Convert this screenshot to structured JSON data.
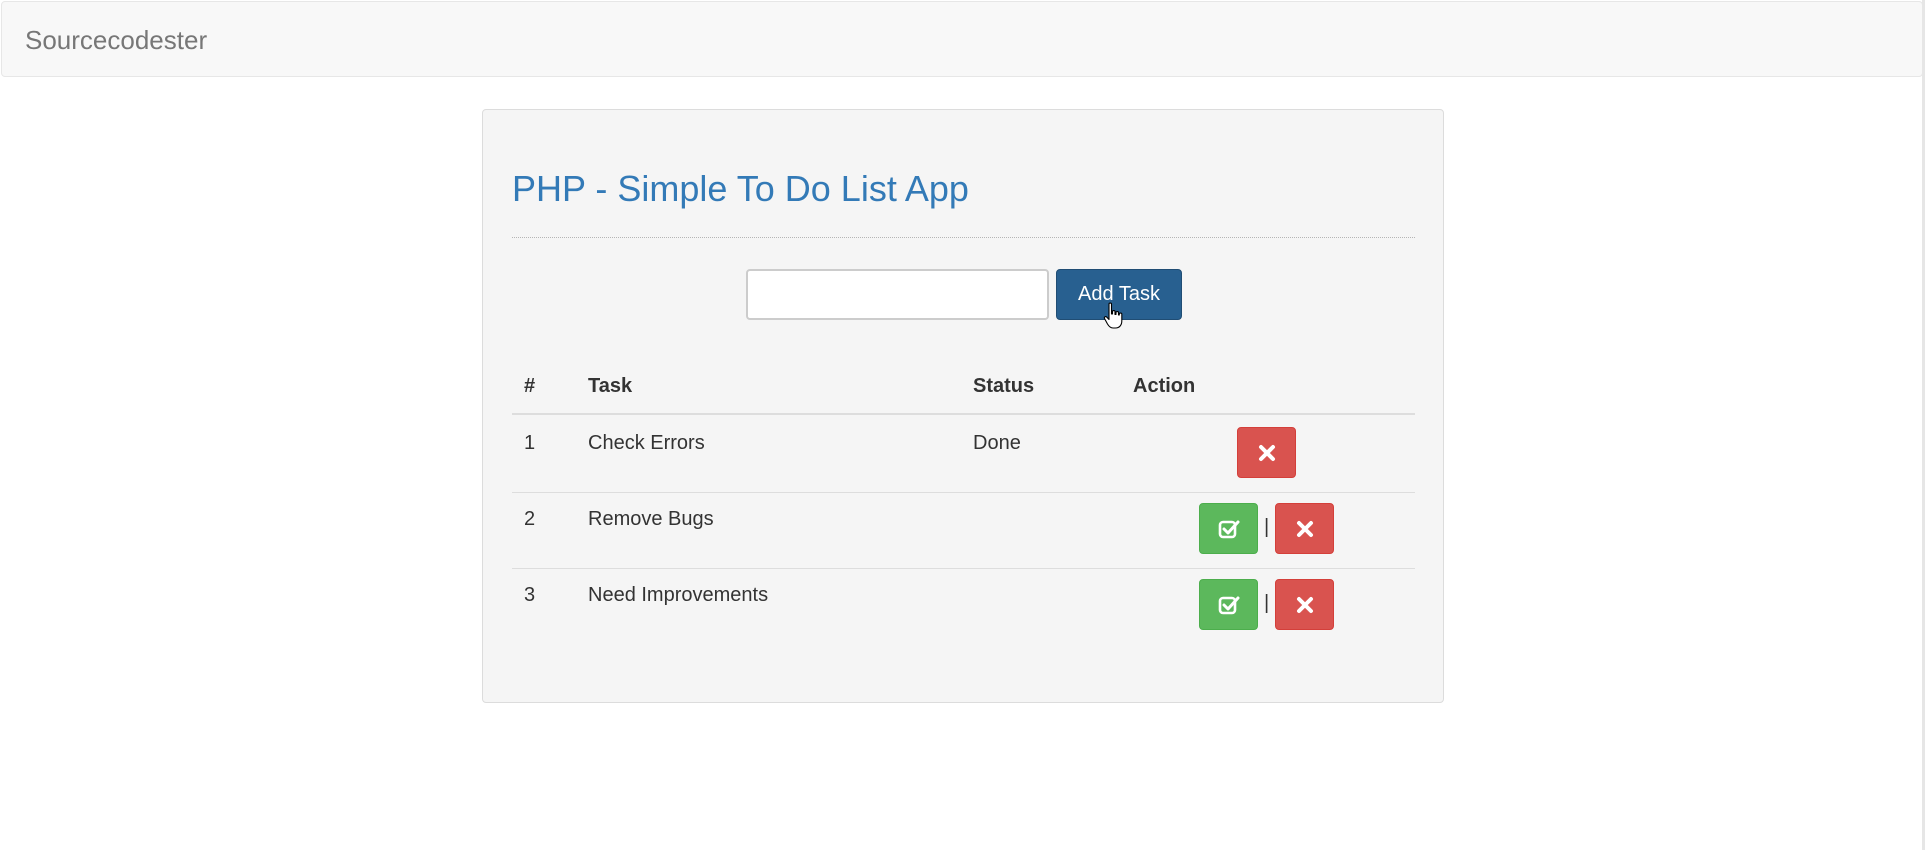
{
  "navbar": {
    "brand": "Sourcecodester"
  },
  "panel": {
    "title": "PHP - Simple To Do List App"
  },
  "form": {
    "input_value": "",
    "input_placeholder": "",
    "add_label": "Add Task"
  },
  "table": {
    "headers": [
      "#",
      "Task",
      "Status",
      "Action"
    ],
    "rows": [
      {
        "num": "1",
        "task": "Check Errors",
        "status": "Done",
        "actions": [
          "delete"
        ]
      },
      {
        "num": "2",
        "task": "Remove Bugs",
        "status": "",
        "actions": [
          "complete",
          "delete"
        ]
      },
      {
        "num": "3",
        "task": "Need Improvements",
        "status": "",
        "actions": [
          "complete",
          "delete"
        ]
      }
    ],
    "action_separator": "|"
  },
  "icons": {
    "complete": "check-square-icon",
    "delete": "times-icon"
  },
  "colors": {
    "primary": "#286090",
    "danger": "#d9534f",
    "success": "#5cb85c",
    "title": "#337ab7"
  }
}
